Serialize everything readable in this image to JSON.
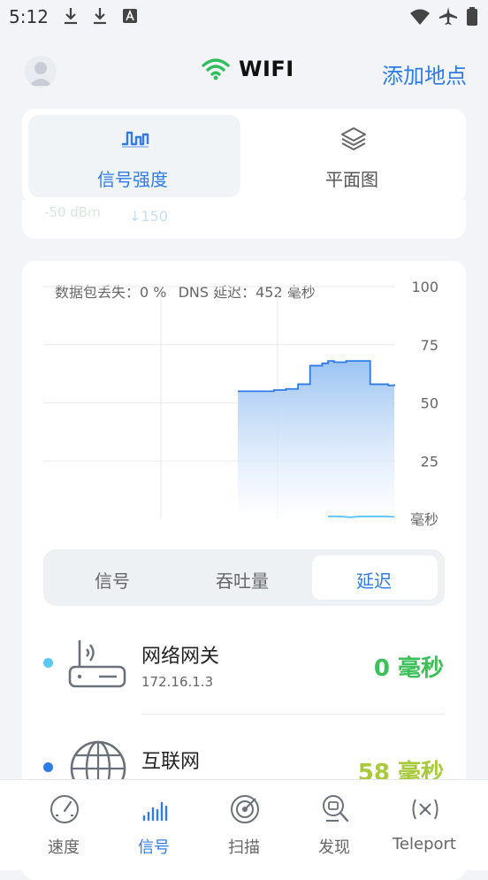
{
  "status_bar": {
    "time": "5:12"
  },
  "header": {
    "title": "WIFI",
    "add_place": "添加地点"
  },
  "top_tabs": [
    {
      "label": "信号强度",
      "selected": true
    },
    {
      "label": "平面图",
      "selected": false
    }
  ],
  "peek_row": {
    "signal": "-50 dBm",
    "speed": "↓150"
  },
  "chart": {
    "packet_loss_label": "数据包丢失：",
    "packet_loss_value": "0 %",
    "dns_label": "DNS 延迟：",
    "dns_value": "452 毫秒",
    "y_ticks": [
      "100",
      "75",
      "50",
      "25"
    ],
    "unit": "毫秒"
  },
  "chart_data": {
    "type": "area",
    "ylabel": "毫秒",
    "ylim": [
      0,
      100
    ],
    "y_ticks": [
      100,
      75,
      50,
      25
    ],
    "grid": true,
    "series": [
      {
        "color": "#2f7be7",
        "points": [
          [
            0,
            55
          ],
          [
            1,
            55
          ],
          [
            2,
            55
          ],
          [
            3,
            55.5
          ],
          [
            4,
            56
          ],
          [
            5,
            58
          ],
          [
            6,
            66
          ],
          [
            7,
            67
          ],
          [
            7.5,
            68
          ],
          [
            8,
            67.5
          ],
          [
            9,
            68
          ],
          [
            10,
            68
          ],
          [
            11,
            58
          ],
          [
            12,
            58
          ],
          [
            12.5,
            57.5
          ],
          [
            13,
            58
          ]
        ]
      },
      {
        "color": "#4fc3f7",
        "points": [
          [
            0,
            1.2
          ],
          [
            1,
            1.2
          ],
          [
            2,
            0.8
          ],
          [
            3,
            1.2
          ],
          [
            4,
            1.2
          ],
          [
            5,
            1.2
          ],
          [
            6,
            1.0
          ]
        ]
      }
    ]
  },
  "segments": [
    {
      "label": "信号",
      "selected": false
    },
    {
      "label": "吞吐量",
      "selected": false
    },
    {
      "label": "延迟",
      "selected": true
    }
  ],
  "rows": [
    {
      "title": "网络网关",
      "subtitle": "172.16.1.3",
      "value": "0 毫秒",
      "dot_color": "#5bc8f5",
      "value_color": "#3cc15a",
      "icon": "router-icon"
    },
    {
      "title": "互联网",
      "subtitle": "",
      "value": "58 毫秒",
      "dot_color": "#2f7be7",
      "value_color": "#a8c93a",
      "icon": "globe-icon"
    }
  ],
  "bottom_nav": [
    {
      "label": "速度",
      "icon": "speedometer-icon",
      "active": false
    },
    {
      "label": "信号",
      "icon": "signal-bars-icon",
      "active": true
    },
    {
      "label": "扫描",
      "icon": "radar-icon",
      "active": false
    },
    {
      "label": "发现",
      "icon": "discover-icon",
      "active": false
    },
    {
      "label": "Teleport",
      "icon": "teleport-icon",
      "active": false
    }
  ],
  "colors": {
    "accent": "#2f7be7",
    "wifi_green": "#2fbf5a"
  }
}
